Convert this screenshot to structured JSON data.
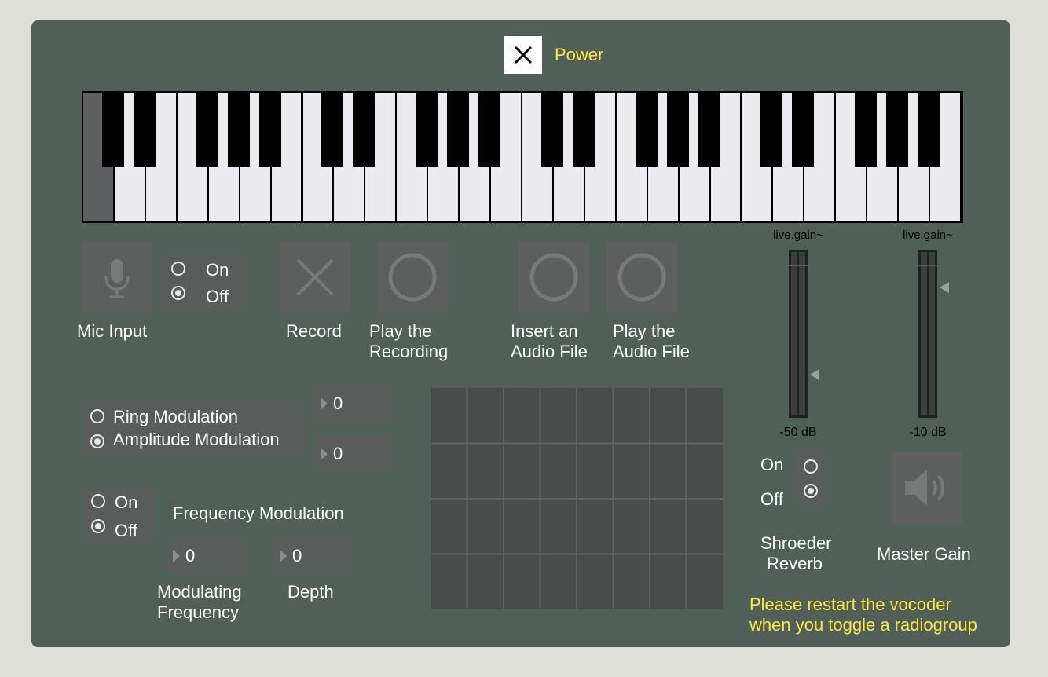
{
  "power": {
    "label": "Power",
    "checked": true
  },
  "keyboard": {
    "white_keys": 28,
    "first_key_highlighted": true
  },
  "mic": {
    "label": "Mic Input",
    "radio": [
      {
        "label": "On",
        "selected": false
      },
      {
        "label": "Off",
        "selected": true
      }
    ]
  },
  "buttons": {
    "record": "Record",
    "play_recording_1": "Play the",
    "play_recording_2": "Recording",
    "insert_audio_1": "Insert an",
    "insert_audio_2": "Audio File",
    "play_audio_1": "Play the",
    "play_audio_2": "Audio File"
  },
  "modulation": {
    "ring": "Ring Modulation",
    "amplitude": "Amplitude Modulation",
    "selected": "amplitude",
    "num1": "0",
    "num2": "0"
  },
  "fm": {
    "on": "On",
    "off": "Off",
    "selected": "off",
    "label": "Frequency Modulation",
    "mod_freq_value": "0",
    "depth_value": "0",
    "mod_freq_label_1": "Modulating",
    "mod_freq_label_2": "Frequency",
    "depth_label": "Depth"
  },
  "grid": {
    "rows": 4,
    "cols": 8
  },
  "meters": [
    {
      "label": "live.gain~",
      "db": "-50 dB",
      "level": 0.25
    },
    {
      "label": "live.gain~",
      "db": "-10 dB",
      "level": 0.8
    }
  ],
  "reverb": {
    "on": "On",
    "off": "Off",
    "selected": "off",
    "label_1": "Shroeder",
    "label_2": "Reverb"
  },
  "master": {
    "label": "Master Gain"
  },
  "notice": {
    "line1": "Please restart the vocoder",
    "line2": "when you toggle a radiogroup"
  },
  "colors": {
    "panel": "#506058",
    "accent_text": "#ffe640",
    "button_bg": "#5c5f5d"
  }
}
